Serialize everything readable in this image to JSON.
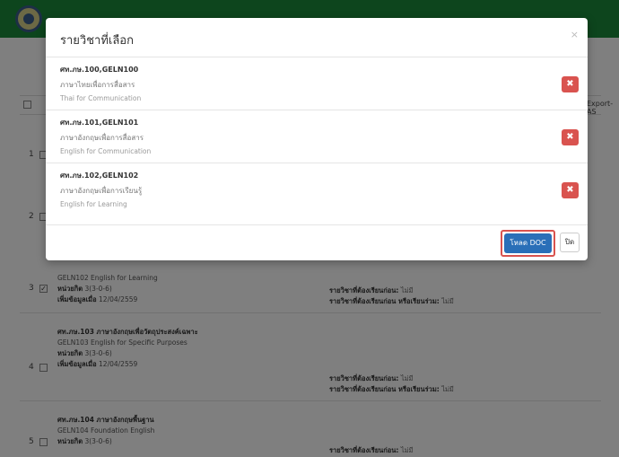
{
  "modal": {
    "title": "รายวิชาที่เลือก",
    "close_glyph": "×",
    "items": [
      {
        "code": "ศท.ภษ.100,GELN100",
        "th_name": "ภาษาไทยเพื่อการสื่อสาร",
        "en_name": "Thai for Communication"
      },
      {
        "code": "ศท.ภษ.101,GELN101",
        "th_name": "ภาษาอังกฤษเพื่อการสื่อสาร",
        "en_name": "English for Communication"
      },
      {
        "code": "ศท.ภษ.102,GELN102",
        "th_name": "ภาษาอังกฤษเพื่อการเรียนรู้",
        "en_name": "English for Learning"
      }
    ],
    "remove_glyph": "✖",
    "download_label": "โหลด DOC",
    "close_label": "ปิด"
  },
  "colors": {
    "topbar": "#1b8a3a",
    "remove": "#d9534f",
    "download": "#2a6fb8",
    "highlight": "#d9534f"
  },
  "background": {
    "export_label": "Export-AS",
    "rows": [
      {
        "num": "3",
        "checked": true,
        "code": "GELN102 English for Learning",
        "credits_label": "หน่วยกิต",
        "credits": "3(3-0-6)",
        "added_label": "เพิ่มข้อมูลเมื่อ",
        "added": "12/04/2559",
        "prereq_label": "รายวิชาที่ต้องเรียนก่อน:",
        "prereq": "ไม่มี",
        "coreq_label": "รายวิชาที่ต้องเรียนก่อน หรือเรียนร่วม:",
        "coreq": "ไม่มี"
      },
      {
        "num": "4",
        "checked": false,
        "title": "ศท.ภษ.103 ภาษาอังกฤษเพื่อวัตถุประสงค์เฉพาะ",
        "code": "GELN103 English for Specific Purposes",
        "credits_label": "หน่วยกิต",
        "credits": "3(3-0-6)",
        "added_label": "เพิ่มข้อมูลเมื่อ",
        "added": "12/04/2559",
        "prereq_label": "รายวิชาที่ต้องเรียนก่อน:",
        "prereq": "ไม่มี",
        "coreq_label": "รายวิชาที่ต้องเรียนก่อน หรือเรียนร่วม:",
        "coreq": "ไม่มี"
      },
      {
        "num": "5",
        "checked": false,
        "title": "ศท.ภษ.104 ภาษาอังกฤษพื้นฐาน",
        "code": "GELN104 Foundation English",
        "credits_label": "หน่วยกิต",
        "credits": "3(3-0-6)",
        "prereq_label": "รายวิชาที่ต้องเรียนก่อน:",
        "prereq": "ไม่มี"
      }
    ]
  }
}
